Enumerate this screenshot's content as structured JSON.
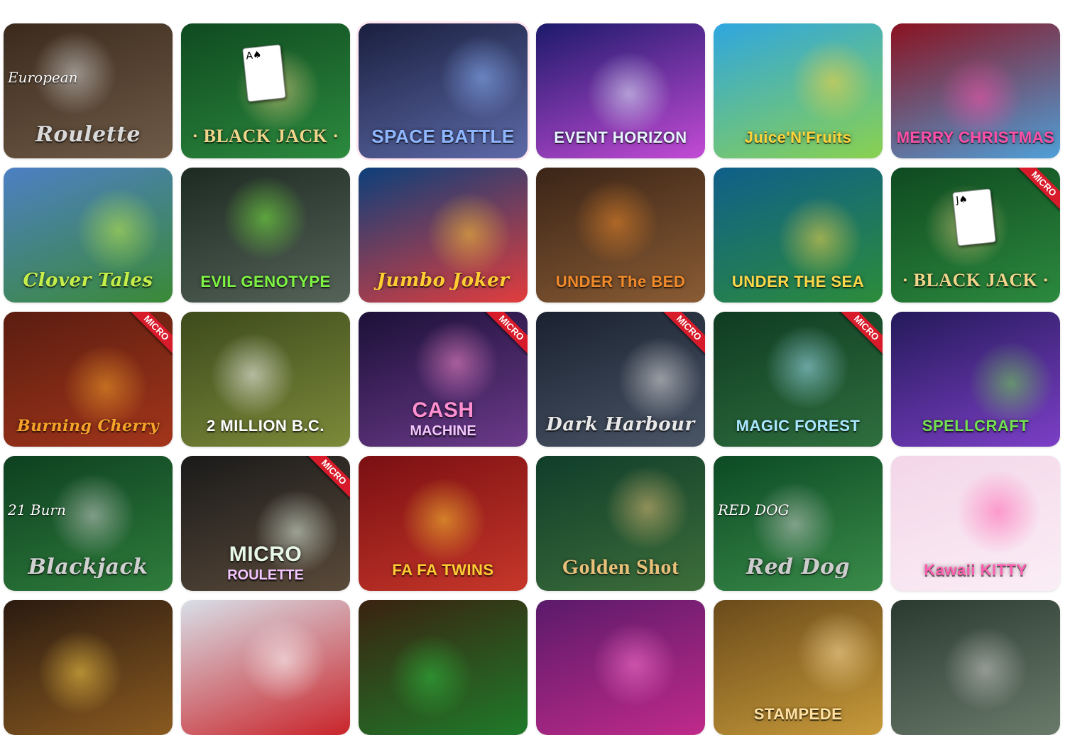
{
  "games": [
    {
      "title": "Roulette",
      "subtitle": "European",
      "bg": [
        "#3b2a1c",
        "#6f5b48"
      ],
      "accent": "#d9d9d9",
      "style": "script",
      "size": "",
      "badge": ""
    },
    {
      "title": "· BLACK JACK ·",
      "bg": [
        "#0f4a20",
        "#2c8a3e"
      ],
      "accent": "#f0d58a",
      "style": "serif",
      "size": "sm",
      "badge": "",
      "card": "A♠"
    },
    {
      "title": "SPACE BATTLE",
      "bg": [
        "#1a1f3f",
        "#5d6aa8"
      ],
      "accent": "#8fb7ff",
      "style": "",
      "size": "sm",
      "badge": "",
      "active": true
    },
    {
      "title": "EVENT HORIZON",
      "bg": [
        "#1c1a6b",
        "#c44bd6"
      ],
      "accent": "#e6f4ff",
      "style": "",
      "size": "xs",
      "badge": ""
    },
    {
      "title": "Juice'N'Fruits",
      "bg": [
        "#2fa6e0",
        "#8ad14f"
      ],
      "accent": "#ffd43a",
      "style": "",
      "size": "xs",
      "badge": ""
    },
    {
      "title": "MERRY CHRISTMAS",
      "bg": [
        "#8a1220",
        "#4fa0d8"
      ],
      "accent": "#ff4fa8",
      "style": "",
      "size": "xs",
      "badge": ""
    },
    {
      "title": "Clover Tales",
      "bg": [
        "#4c7fc4",
        "#3a8a36"
      ],
      "accent": "#c5ee4a",
      "style": "script",
      "size": "sm",
      "badge": ""
    },
    {
      "title": "EVIL GENOTYPE",
      "bg": [
        "#1d2a22",
        "#556359"
      ],
      "accent": "#7ef542",
      "style": "",
      "size": "xs",
      "badge": ""
    },
    {
      "title": "Jumbo Joker",
      "bg": [
        "#0c3f7a",
        "#e23d3d"
      ],
      "accent": "#ffcc33",
      "style": "script",
      "size": "sm",
      "badge": ""
    },
    {
      "title": "UNDER The BED",
      "bg": [
        "#3a2417",
        "#8a5c34"
      ],
      "accent": "#f08a2a",
      "style": "",
      "size": "xs",
      "badge": ""
    },
    {
      "title": "UNDER THE SEA",
      "bg": [
        "#0f5f8a",
        "#2c8c3a"
      ],
      "accent": "#ffd84a",
      "style": "",
      "size": "xs",
      "badge": ""
    },
    {
      "title": "· BLACK JACK ·",
      "bg": [
        "#0f4a20",
        "#2c8a3e"
      ],
      "accent": "#f0d58a",
      "style": "serif",
      "size": "sm",
      "badge": "MICRO",
      "card": "J♠"
    },
    {
      "title": "Burning Cherry",
      "bg": [
        "#5a1d10",
        "#a3351b"
      ],
      "accent": "#f7a32a",
      "style": "script",
      "size": "xs",
      "badge": "MICRO"
    },
    {
      "title": "2 MILLION B.C.",
      "bg": [
        "#3d4a1c",
        "#7c8a3a"
      ],
      "accent": "#ffffff",
      "style": "",
      "size": "xs",
      "badge": ""
    },
    {
      "title": "CASH",
      "subtitle2": "MACHINE",
      "bg": [
        "#1b1038",
        "#6c3a8a"
      ],
      "accent": "#ff8fd0",
      "style": "",
      "size": "",
      "badge": "MICRO"
    },
    {
      "title": "Dark Harbour",
      "bg": [
        "#1a2230",
        "#4a5566"
      ],
      "accent": "#e8e8e8",
      "style": "script",
      "size": "sm",
      "badge": "MICRO"
    },
    {
      "title": "MAGIC FOREST",
      "bg": [
        "#0f3b22",
        "#2f6f3e"
      ],
      "accent": "#a8e8ff",
      "style": "",
      "size": "xs",
      "badge": "MICRO"
    },
    {
      "title": "SPELLCRAFT",
      "bg": [
        "#241a5a",
        "#7c3fc7"
      ],
      "accent": "#72e04f",
      "style": "",
      "size": "xs",
      "badge": ""
    },
    {
      "title": "Blackjack",
      "subtitle": "21 Burn",
      "bg": [
        "#0d4020",
        "#2f7d3c"
      ],
      "accent": "#d0d0d0",
      "style": "script",
      "size": "",
      "badge": ""
    },
    {
      "title": "MICRO",
      "subtitle2": "ROULETTE",
      "bg": [
        "#1a1a1a",
        "#5a4a3a"
      ],
      "accent": "#e8f8e8",
      "style": "",
      "size": "",
      "badge": "MICRO"
    },
    {
      "title": "FA FA TWINS",
      "bg": [
        "#7a0f12",
        "#c7372a"
      ],
      "accent": "#ffcc33",
      "style": "",
      "size": "xs",
      "badge": ""
    },
    {
      "title": "Golden Shot",
      "bg": [
        "#0f3d2a",
        "#3d6e3a"
      ],
      "accent": "#e8c07a",
      "style": "serif",
      "size": "",
      "badge": ""
    },
    {
      "title": "Red Dog",
      "subtitle": "RED DOG",
      "bg": [
        "#0c4a24",
        "#3a8c4a"
      ],
      "accent": "#cccccc",
      "style": "script",
      "size": "",
      "badge": ""
    },
    {
      "title": "Kawaii KITTY",
      "bg": [
        "#f3d6e8",
        "#fbeef6"
      ],
      "accent": "#ff5fb0",
      "style": "",
      "size": "xs",
      "badge": ""
    },
    {
      "title": "",
      "bg": [
        "#2a1a10",
        "#8a5a20"
      ],
      "accent": "#ffd24a",
      "style": "",
      "size": "",
      "badge": ""
    },
    {
      "title": "",
      "bg": [
        "#d8dfe8",
        "#c9242a"
      ],
      "accent": "#ffffff",
      "style": "",
      "size": "",
      "badge": ""
    },
    {
      "title": "",
      "bg": [
        "#3a2210",
        "#1f7a2a"
      ],
      "accent": "#2fbf3f",
      "style": "",
      "size": "",
      "badge": ""
    },
    {
      "title": "",
      "bg": [
        "#5a1a6a",
        "#c02a8a"
      ],
      "accent": "#ff7ad0",
      "style": "",
      "size": "",
      "badge": ""
    },
    {
      "title": "STAMPEDE",
      "bg": [
        "#6a4a1a",
        "#c79a3a"
      ],
      "accent": "#ffe0a0",
      "style": "",
      "size": "xs",
      "badge": ""
    },
    {
      "title": "",
      "bg": [
        "#2a3a30",
        "#6a7a6a"
      ],
      "accent": "#cccccc",
      "style": "",
      "size": "",
      "badge": ""
    }
  ]
}
